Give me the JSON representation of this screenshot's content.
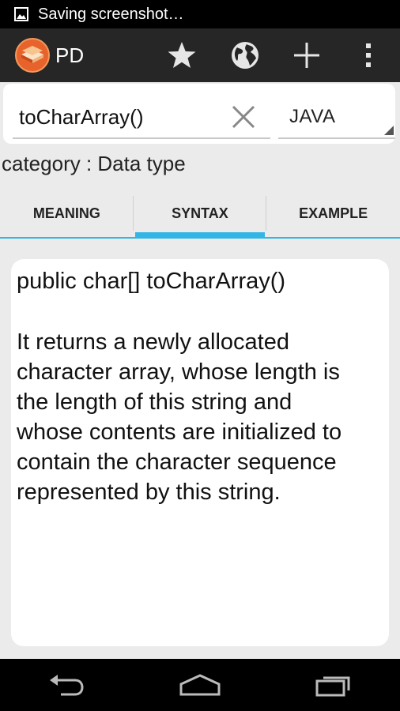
{
  "status_bar": {
    "text": "Saving screenshot…",
    "icon": "image-icon"
  },
  "action_bar": {
    "title": "PD",
    "logo": "books-logo",
    "actions": [
      "star-icon",
      "globe-icon",
      "plus-icon",
      "overflow-menu-icon"
    ]
  },
  "search": {
    "value": "toCharArray()",
    "clear_icon": "close-icon",
    "language": "JAVA"
  },
  "category": "category :  Data type",
  "tabs": [
    {
      "label": "MEANING",
      "active": false
    },
    {
      "label": "SYNTAX",
      "active": true
    },
    {
      "label": "EXAMPLE",
      "active": false
    }
  ],
  "content": {
    "syntax": "public char[] toCharArray()",
    "description_lines": [
      "It returns a newly allocated",
      "character array, whose length is",
      "the length of this string and",
      "whose contents are initialized to",
      "contain the character sequence",
      "represented by this string."
    ]
  },
  "nav_bar": [
    "back-icon",
    "home-icon",
    "recent-apps-icon"
  ],
  "colors": {
    "accent": "#33b5e5",
    "action_bar": "#262626",
    "background": "#ebebeb"
  }
}
